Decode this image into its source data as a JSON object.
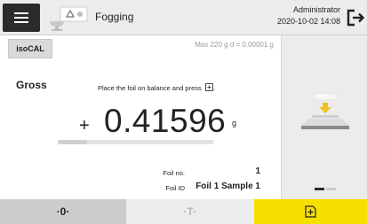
{
  "header": {
    "app_title": "Fogging",
    "user": "Administrator",
    "datetime": "2020-10-02  14:08",
    "menu_icon": "hamburger-menu-icon",
    "app_icon": "balance-delta-icon",
    "logout_icon": "logout-icon"
  },
  "main": {
    "iscal_label": "isoCAL",
    "capacity": "Max 220 g   d = 0.00001 g",
    "mode_label": "Gross",
    "instruction": "Place the foil on balance and press",
    "sign": "+",
    "weight": "0.41596",
    "unit": "g",
    "progress_fraction": 0.19,
    "foil_no_label": "Foil no.",
    "foil_no_value": "1",
    "foil_id_label": "Foil ID",
    "foil_id_value": "Foil 1 Sample 1"
  },
  "side_panel": {
    "graphic": "place-on-balance-icon",
    "page_indicator": {
      "pages": 2,
      "active": 1
    }
  },
  "footer": {
    "zero_label": "·0·",
    "tare_label": "·T·",
    "confirm_icon": "confirm-key-icon"
  },
  "colors": {
    "accent_yellow": "#f5e000",
    "arrow_yellow": "#f0c020",
    "header_bg": "#ececec",
    "dark": "#2b2b2b"
  }
}
